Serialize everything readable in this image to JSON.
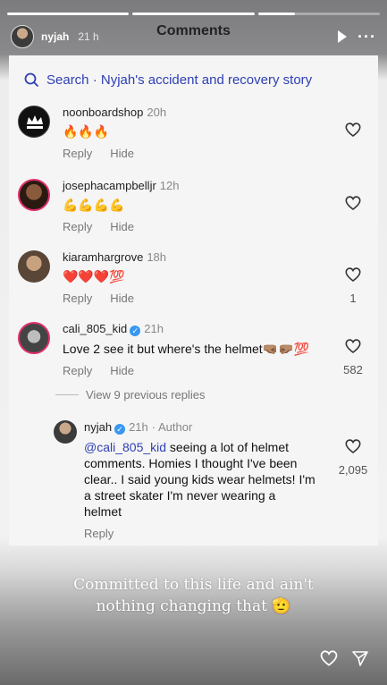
{
  "story": {
    "progress": [
      1,
      1,
      0.3
    ],
    "user": "nyjah",
    "time": "21 h",
    "title": "Comments"
  },
  "search": {
    "label": "Search · Nyjah's accident and recovery story"
  },
  "comments": [
    {
      "user": "noonboardshop",
      "time": "20h",
      "text": "🔥🔥🔥",
      "reply": "Reply",
      "hide": "Hide",
      "likes": ""
    },
    {
      "user": "josephacampbelljr",
      "time": "12h",
      "text": "💪💪💪💪",
      "reply": "Reply",
      "hide": "Hide",
      "likes": ""
    },
    {
      "user": "kiaramhargrove",
      "time": "18h",
      "text": "❤️❤️❤️💯",
      "reply": "Reply",
      "hide": "Hide",
      "likes": "1"
    },
    {
      "user": "cali_805_kid",
      "time": "21h",
      "text": "Love 2 see it but where's the helmet🤜🏽🤛🏽💯",
      "reply": "Reply",
      "hide": "Hide",
      "likes": "582"
    }
  ],
  "view_replies": "View 9 previous replies",
  "author_reply": {
    "user": "nyjah",
    "time": "21h",
    "author_tag": "· Author",
    "mention": "@cali_805_kid",
    "text": " seeing a lot of helmet comments. Homies I thought I've been clear.. I said young kids wear helmets! I'm a street skater I'm never wearing a helmet",
    "reply": "Reply",
    "likes": "2,095"
  },
  "caption": {
    "line1": "Committed to this life and ain't",
    "line2": "nothing changing that 🫡"
  },
  "icons": {
    "search": "search-icon",
    "heart": "heart-icon",
    "share": "send-icon",
    "play": "play-icon",
    "more": "more-icon"
  }
}
